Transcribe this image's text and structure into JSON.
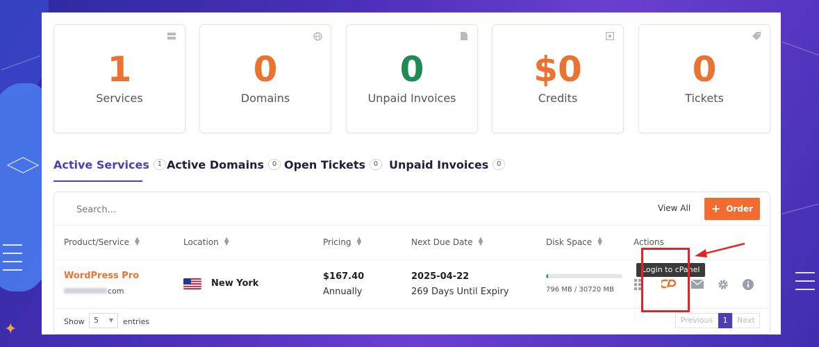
{
  "stats": [
    {
      "value": "1",
      "label": "Services",
      "color": "#e9732f",
      "icon": "server-icon"
    },
    {
      "value": "0",
      "label": "Domains",
      "color": "#e9732f",
      "icon": "globe-icon"
    },
    {
      "value": "0",
      "label": "Unpaid Invoices",
      "color": "#1f8a55",
      "icon": "document-icon"
    },
    {
      "value": "$0",
      "label": "Credits",
      "color": "#e9732f",
      "icon": "wallet-icon"
    },
    {
      "value": "0",
      "label": "Tickets",
      "color": "#e9732f",
      "icon": "tag-icon"
    }
  ],
  "tabs": [
    {
      "label": "Active Services",
      "count": "1",
      "active": true
    },
    {
      "label": "Active Domains",
      "count": "0",
      "active": false
    },
    {
      "label": "Open Tickets",
      "count": "0",
      "active": false
    },
    {
      "label": "Unpaid Invoices",
      "count": "0",
      "active": false
    }
  ],
  "toolbar": {
    "search_placeholder": "Search...",
    "view_all": "View All",
    "order_label": "Order"
  },
  "columns": [
    "Product/Service",
    "Location",
    "Pricing",
    "Next Due Date",
    "Disk Space",
    "Actions"
  ],
  "row": {
    "product": "WordPress Pro",
    "domain_suffix": "com",
    "location": "New York",
    "price": "$167.40",
    "cycle": "Annually",
    "due_date": "2025-04-22",
    "expiry": "269 Days Until Expiry",
    "disk_used_fraction": 0.026,
    "disk_text": "796 MB / 30720 MB",
    "tooltip": "Login to cPanel"
  },
  "footer": {
    "show": "Show",
    "page_size": "5",
    "entries": "entries",
    "previous": "Previous",
    "page": "1",
    "next": "Next"
  },
  "colors": {
    "accent": "#4c3fb2",
    "orange": "#f26b30",
    "annotation": "#e42424"
  }
}
